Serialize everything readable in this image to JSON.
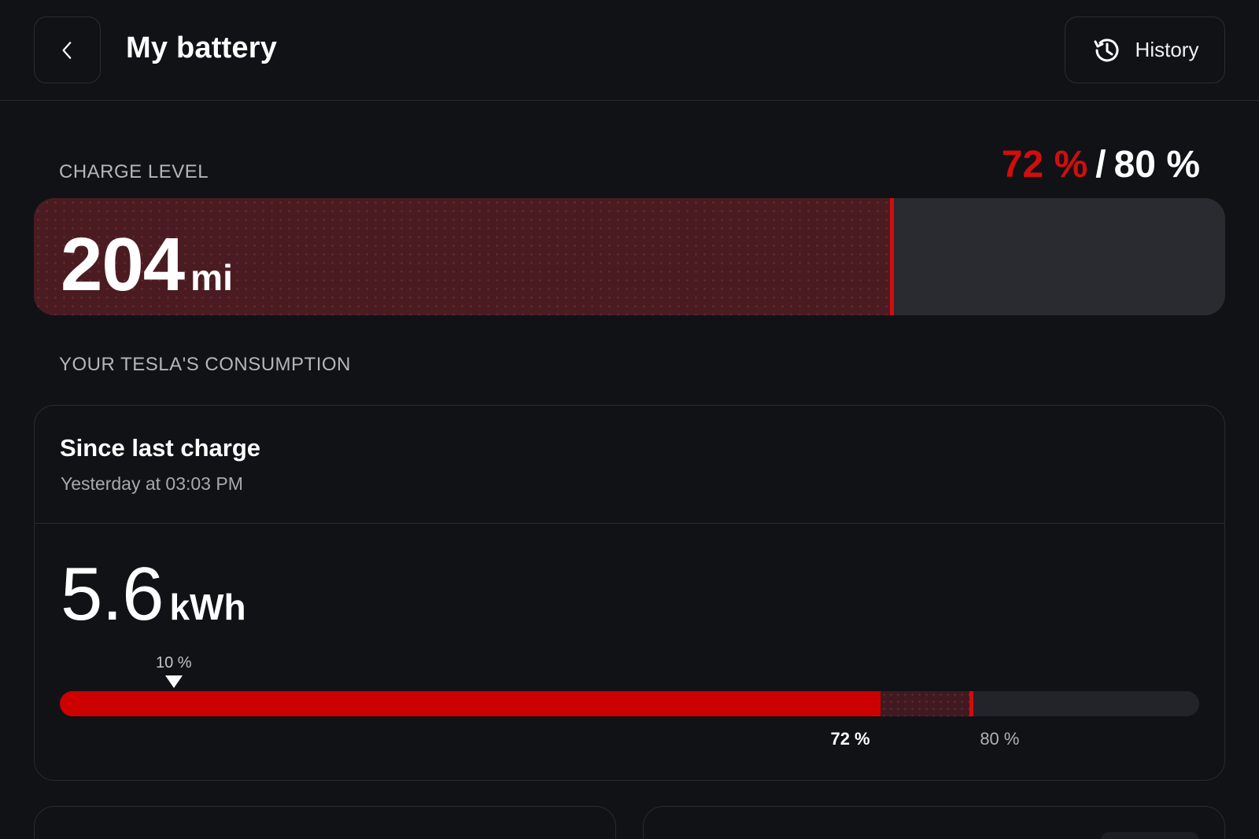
{
  "header": {
    "title": "My battery",
    "history_label": "History"
  },
  "charge": {
    "section_label": "CHARGE LEVEL",
    "current_label": "72 %",
    "separator": "/",
    "limit_label": "80 %",
    "current_fraction": 0.72,
    "limit_fraction": 0.8,
    "range_value": "204",
    "range_unit": "mi"
  },
  "consumption": {
    "section_label": "YOUR TESLA'S CONSUMPTION",
    "card_title": "Since last charge",
    "card_subtitle": "Yesterday at 03:03 PM",
    "energy_value": "5.6",
    "energy_unit": "kWh",
    "start_label": "10 %",
    "start_fraction": 0.1,
    "current_label": "72 %",
    "current_fraction": 0.72,
    "limit_label": "80 %",
    "limit_fraction": 0.8
  },
  "colors": {
    "accent": "#cc0000",
    "background": "#111216",
    "track": "#2a2b30"
  }
}
